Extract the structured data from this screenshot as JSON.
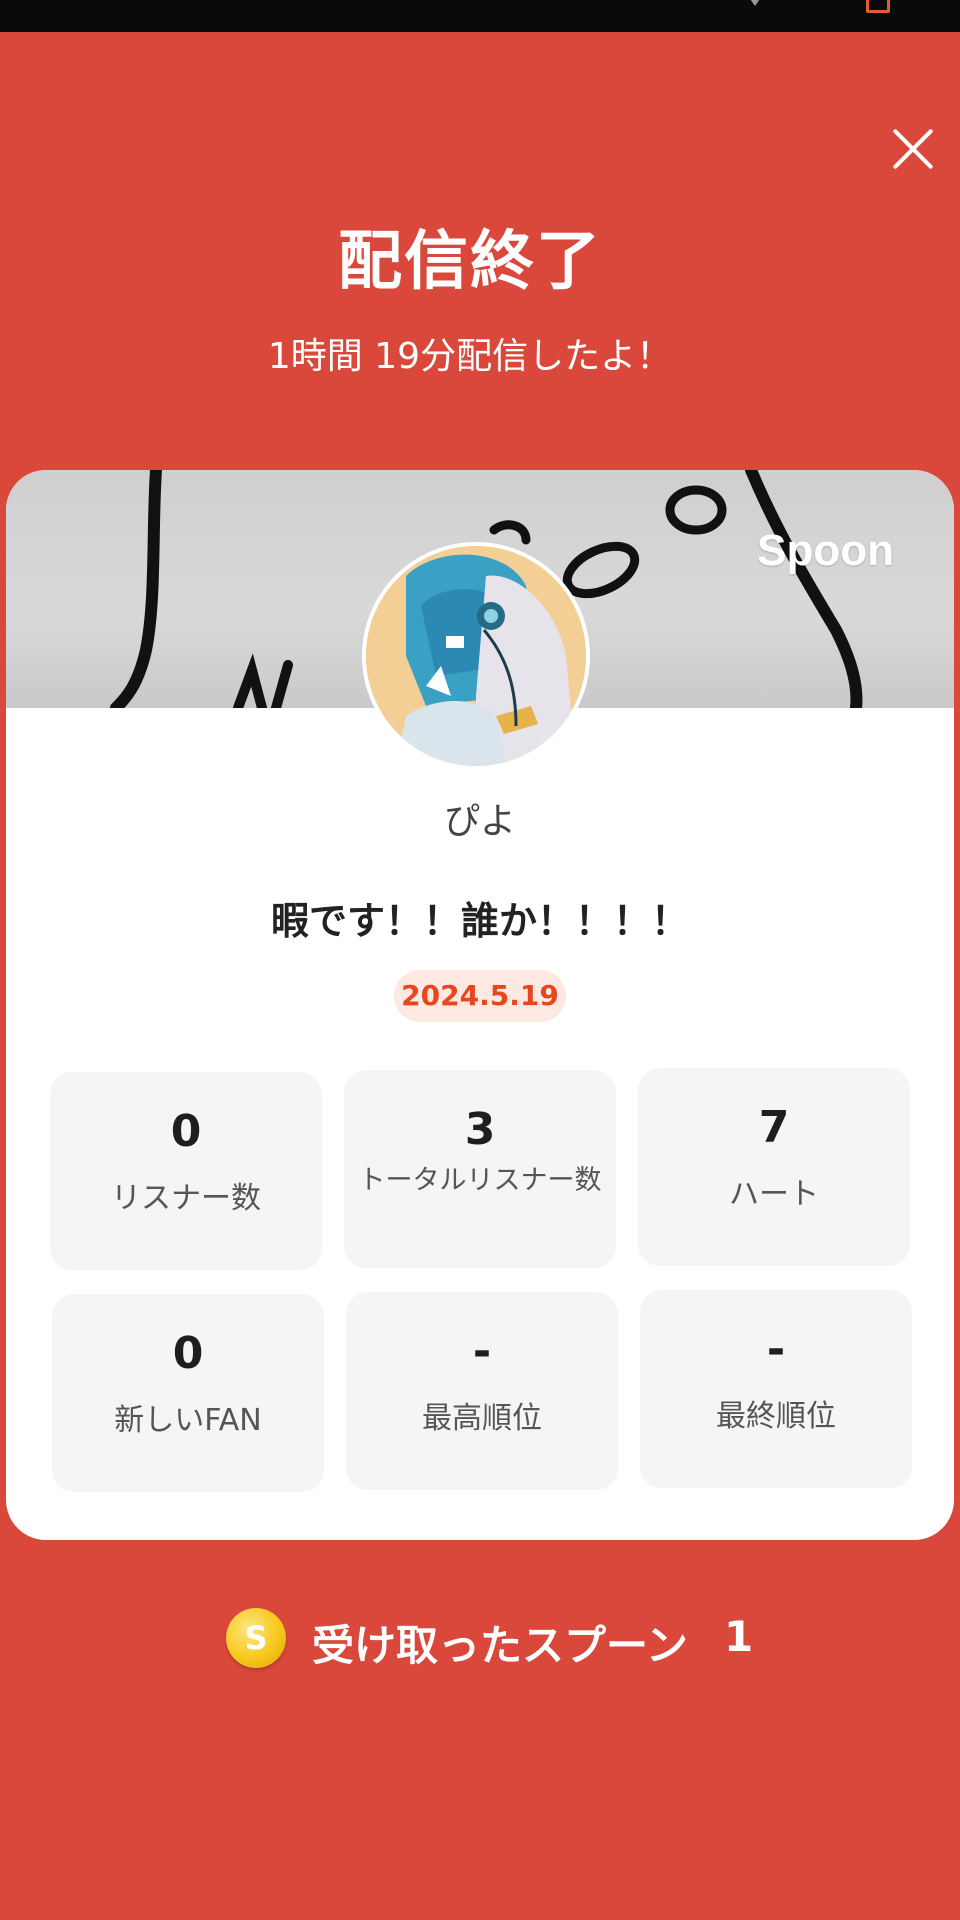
{
  "summary": {
    "title": "配信終了",
    "duration_text": "1時間 19分配信したよ！"
  },
  "card": {
    "brand": "Spoon",
    "username": "ぴよ",
    "live_title": "暇です！！誰か！！！！",
    "date": "2024.5.19",
    "stats": [
      {
        "value": "0",
        "label": "リスナー数"
      },
      {
        "value": "3",
        "label": "トータルリスナー数"
      },
      {
        "value": "7",
        "label": "ハート"
      },
      {
        "value": "0",
        "label": "新しいFAN"
      },
      {
        "value": "-",
        "label": "最高順位"
      },
      {
        "value": "-",
        "label": "最終順位"
      }
    ]
  },
  "spoons": {
    "label": "受け取ったスプーン",
    "count": "1",
    "coin_glyph": "S"
  },
  "icons": {
    "close": "close-icon",
    "coin": "coin-icon"
  },
  "colors": {
    "background": "#d9483a",
    "card": "#ffffff",
    "tile": "#f5f5f5",
    "date_badge_bg": "#fde8e2",
    "date_badge_text": "#e8471e",
    "coin": "#f7c81c"
  }
}
